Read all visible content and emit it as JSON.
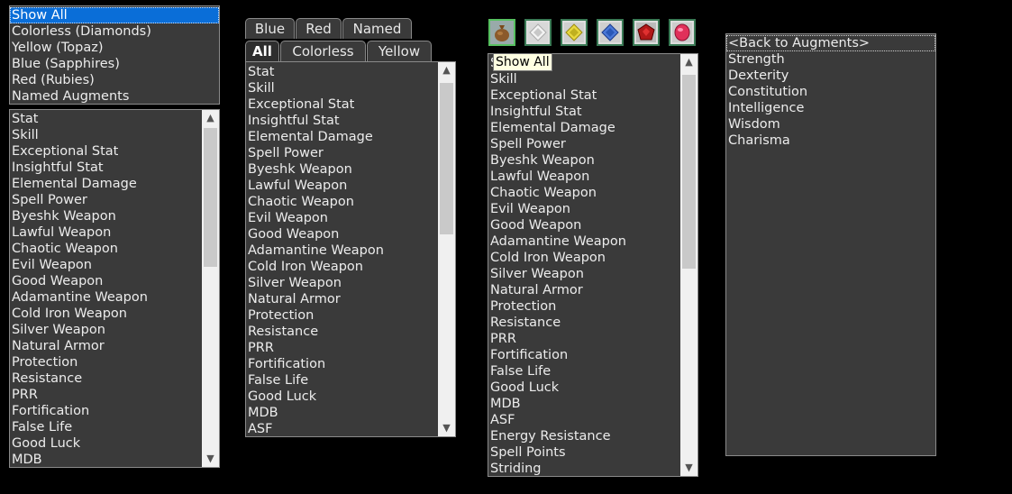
{
  "panel1": {
    "categories": [
      "Show All",
      "Colorless (Diamonds)",
      "Yellow (Topaz)",
      "Blue (Sapphires)",
      "Red (Rubies)",
      "Named Augments"
    ],
    "list": [
      "Stat",
      "Skill",
      "Exceptional Stat",
      "Insightful Stat",
      "Elemental Damage",
      "Spell Power",
      "Byeshk Weapon",
      "Lawful Weapon",
      "Chaotic Weapon",
      "Evil Weapon",
      "Good Weapon",
      "Adamantine Weapon",
      "Cold Iron Weapon",
      "Silver Weapon",
      "Natural Armor",
      "Protection",
      "Resistance",
      "PRR",
      "Fortification",
      "False Life",
      "Good Luck",
      "MDB"
    ]
  },
  "panel2": {
    "tabs_back": [
      "Blue",
      "Red",
      "Named"
    ],
    "tabs_front": [
      "All",
      "Colorless",
      "Yellow"
    ],
    "list": [
      "Stat",
      "Skill",
      "Exceptional Stat",
      "Insightful Stat",
      "Elemental Damage",
      "Spell Power",
      "Byeshk Weapon",
      "Lawful Weapon",
      "Chaotic Weapon",
      "Evil Weapon",
      "Good Weapon",
      "Adamantine Weapon",
      "Cold Iron Weapon",
      "Silver Weapon",
      "Natural Armor",
      "Protection",
      "Resistance",
      "PRR",
      "Fortification",
      "False Life",
      "Good Luck",
      "MDB",
      "ASF"
    ]
  },
  "panel3": {
    "icons": [
      "bag-icon",
      "diamond-gem-icon",
      "topaz-gem-icon",
      "sapphire-gem-icon",
      "ruby-gem-icon",
      "named-augment-gem-icon"
    ],
    "tooltip": "Show All",
    "list": [
      "Stat",
      "Skill",
      "Exceptional Stat",
      "Insightful Stat",
      "Elemental Damage",
      "Spell Power",
      "Byeshk Weapon",
      "Lawful Weapon",
      "Chaotic Weapon",
      "Evil Weapon",
      "Good Weapon",
      "Adamantine Weapon",
      "Cold Iron Weapon",
      "Silver Weapon",
      "Natural Armor",
      "Protection",
      "Resistance",
      "PRR",
      "Fortification",
      "False Life",
      "Good Luck",
      "MDB",
      "ASF",
      "Energy Resistance",
      "Spell Points",
      "Striding"
    ]
  },
  "panel4": {
    "list": [
      "<Back to Augments>",
      "Strength",
      "Dexterity",
      "Constitution",
      "Intelligence",
      "Wisdom",
      "Charisma"
    ]
  }
}
